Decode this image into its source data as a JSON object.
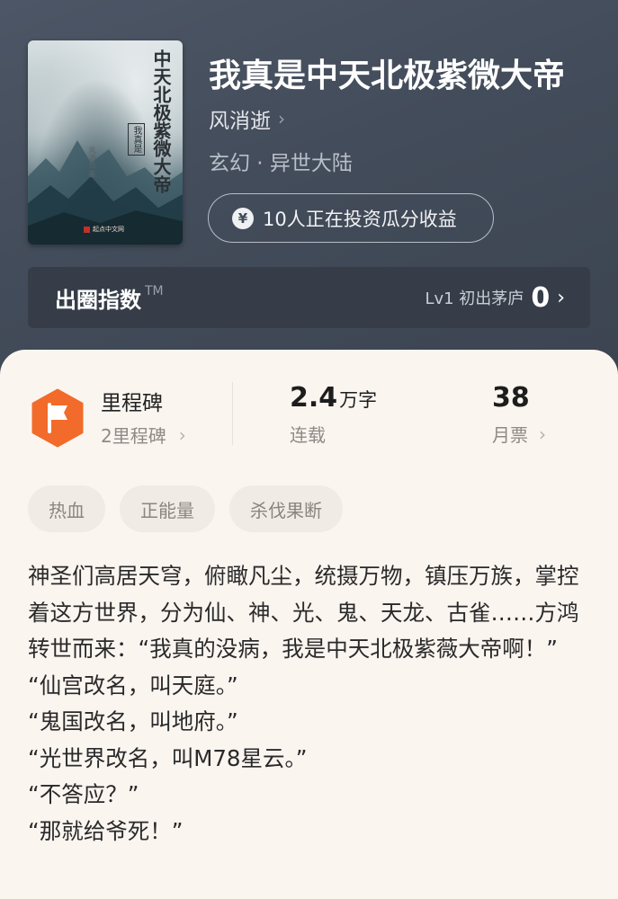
{
  "book": {
    "title": "我真是中天北极紫微大帝",
    "author": "风消逝",
    "genre": "玄幻 · 异世大陆",
    "invest_label": "10人正在投资瓜分收益",
    "cover": {
      "title": "中天北极紫微大帝",
      "seal": "我真是",
      "author": "风消逝 著",
      "publisher": "起点中文网"
    }
  },
  "quanquan": {
    "title": "出圈指数",
    "tm": "TM",
    "level": "Lv1 初出茅庐",
    "value": "0"
  },
  "stats": {
    "milestone_title": "里程碑",
    "milestone_sub": "2里程碑",
    "words_value": "2.4",
    "words_unit": "万字",
    "words_label": "连载",
    "tickets_value": "38",
    "tickets_label": "月票"
  },
  "tags": [
    "热血",
    "正能量",
    "杀伐果断"
  ],
  "description": [
    "神圣们高居天穹，俯瞰凡尘，统摄万物，镇压万族，掌控着这方世界，分为仙、神、光、鬼、天龙、古雀……方鸿转世而来：“我真的没病，我是中天北极紫薇大帝啊！”",
    "“仙宫改名，叫天庭。”",
    "“鬼国改名，叫地府。”",
    "“光世界改名，叫M78星云。”",
    "“不答应？”",
    "“那就给爷死！”"
  ],
  "colors": {
    "header_bg": "#46505e",
    "card_bg": "#fbf5f0",
    "milestone_orange": "#f26b2a"
  }
}
